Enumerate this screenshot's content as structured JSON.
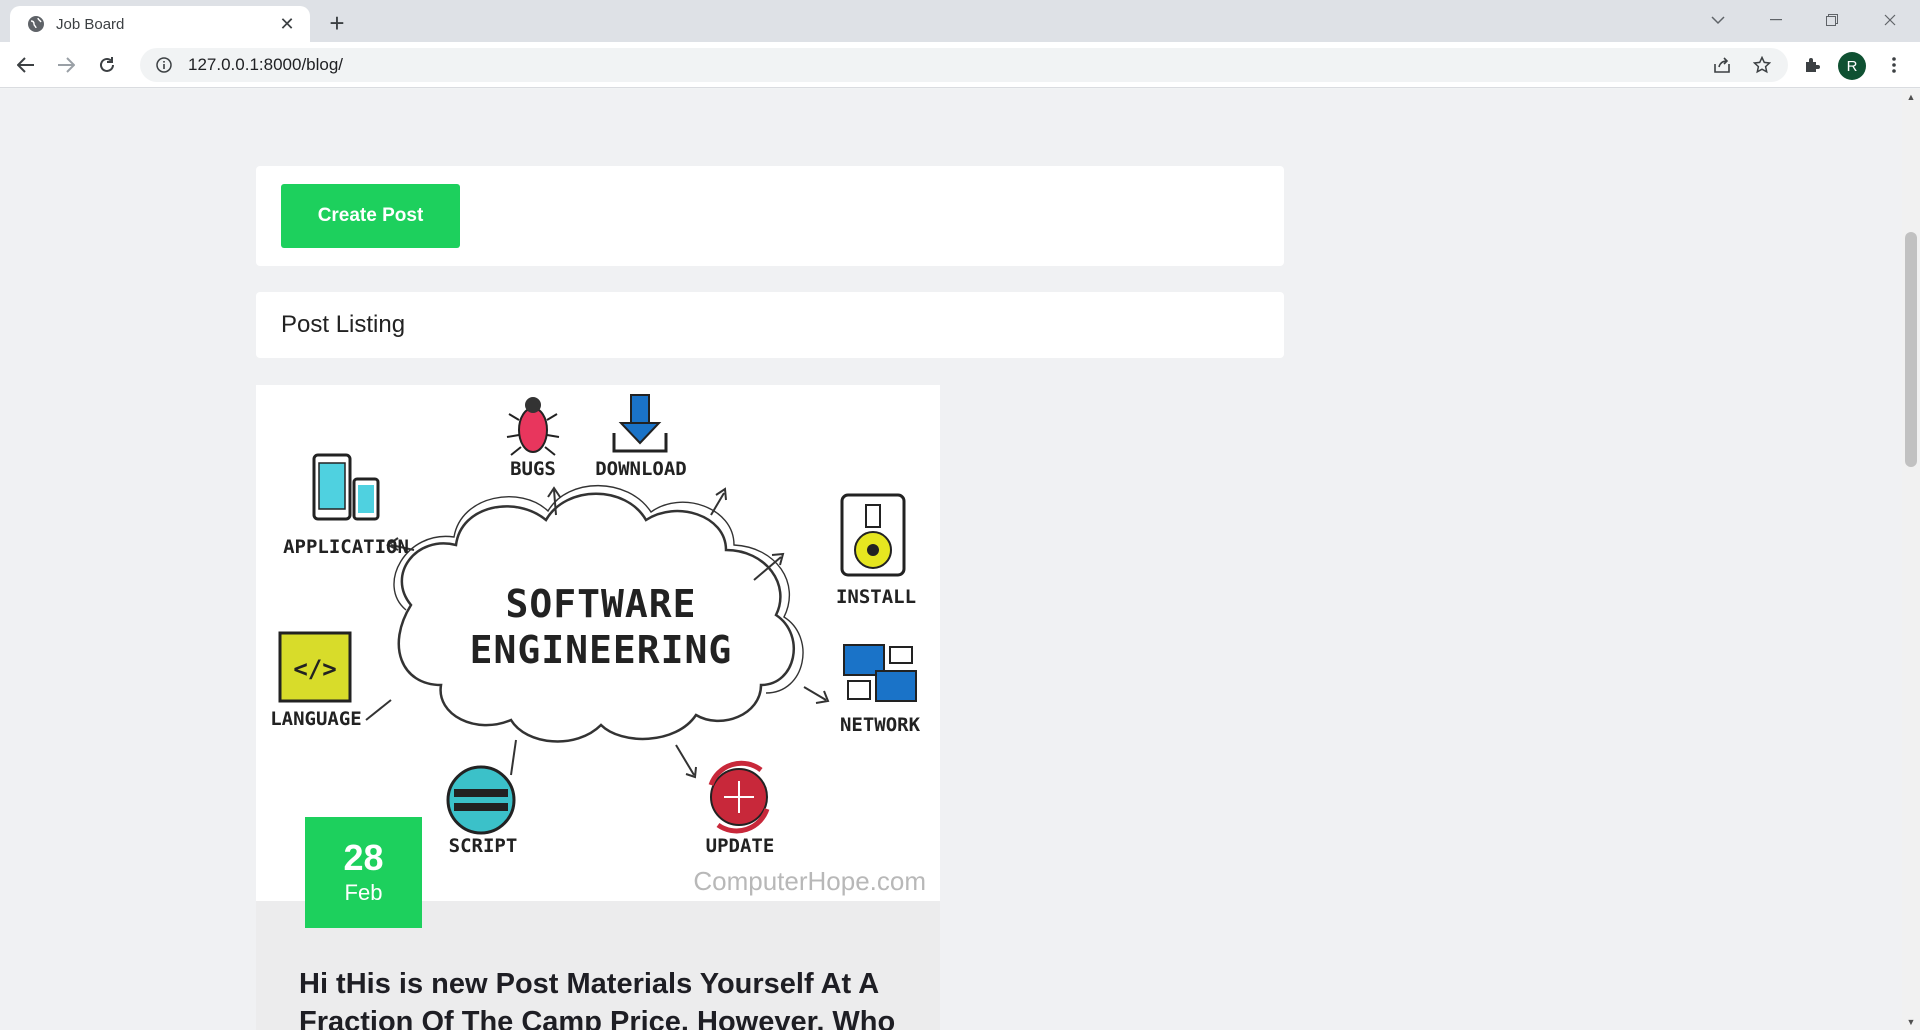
{
  "browser": {
    "tab_title": "Job Board",
    "url": "127.0.0.1:8000/blog/",
    "profile_initial": "R"
  },
  "page": {
    "create_button_label": "Create Post",
    "listing_heading": "Post Listing"
  },
  "post": {
    "image": {
      "center_line1": "SOFTWARE",
      "center_line2": "ENGINEERING",
      "labels": {
        "bugs": "BUGS",
        "download": "DOWNLOAD",
        "application": "APPLICATION",
        "install": "INSTALL",
        "language": "LANGUAGE",
        "network": "NETWORK",
        "script": "SCRIPT",
        "update": "UPDATE"
      },
      "watermark": "ComputerHope.com"
    },
    "date_day": "28",
    "date_month": "Feb",
    "title": "Hi tHis is new Post Materials Yourself At A Fraction Of The Camp Price. However, Who"
  },
  "colors": {
    "accent_green": "#1dd05d",
    "page_background": "#f0f1f3"
  }
}
